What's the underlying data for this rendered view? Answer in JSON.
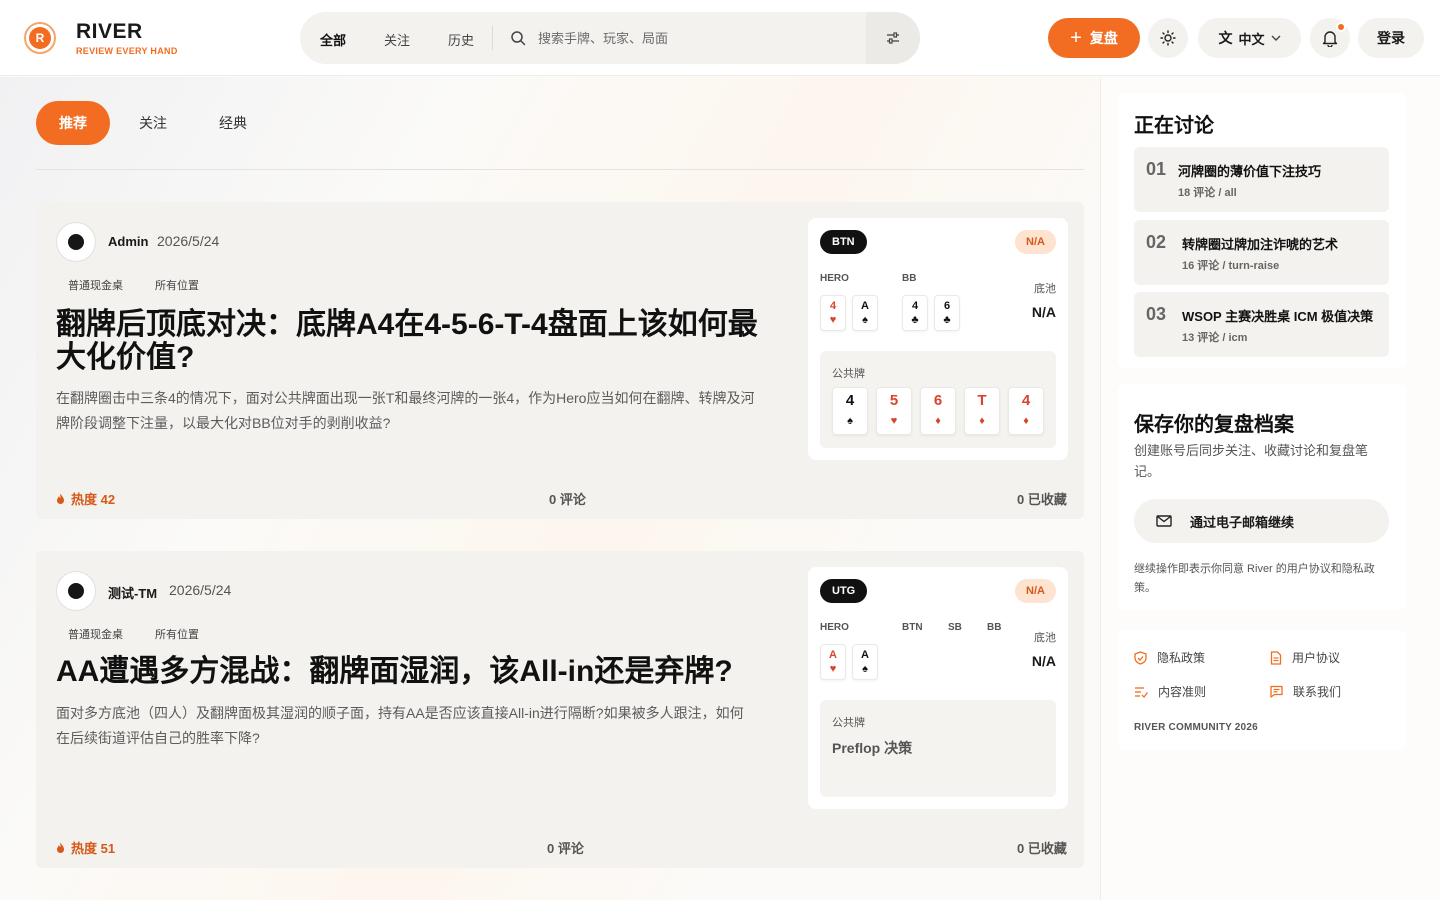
{
  "brand": {
    "logo_letter": "R",
    "name": "RIVER",
    "tagline": "REVIEW EVERY HAND"
  },
  "nav": {
    "tabs": [
      {
        "label": "全部",
        "active": true
      },
      {
        "label": "关注",
        "active": false
      },
      {
        "label": "历史",
        "active": false
      }
    ],
    "search_placeholder": "搜索手牌、玩家、局面"
  },
  "header_actions": {
    "review_label": "复盘",
    "language_label": "中文",
    "login_label": "登录",
    "has_notification": true
  },
  "feed_tabs": [
    {
      "label": "推荐",
      "active": true
    },
    {
      "label": "关注",
      "active": false
    },
    {
      "label": "经典",
      "active": false
    }
  ],
  "posts": [
    {
      "author": "Admin",
      "date": "2026/5/24",
      "tags": [
        "普通现金桌",
        "所有位置"
      ],
      "title": "翻牌后顶底对决：底牌A4在4-5-6-T-4盘面上该如何最大化价值?",
      "description": "在翻牌圈击中三条4的情况下，面对公共牌面出现一张T和最终河牌的一张4，作为Hero应当如何在翻牌、转牌及河牌阶段调整下注量，以最大化对BB位对手的剥削收益?",
      "hot_label": "热度 42",
      "comments_label": "0 评论",
      "saves_label": "0 已收藏",
      "hand": {
        "position": "BTN",
        "result": "N/A",
        "pot_label": "底池",
        "pot_value": "N/A",
        "seats": [
          "HERO",
          "BB"
        ],
        "hero_cards": [
          {
            "rank": "4",
            "suit": "♥",
            "color": "red"
          },
          {
            "rank": "A",
            "suit": "♠",
            "color": "black"
          }
        ],
        "villain_cards": [
          {
            "rank": "4",
            "suit": "♣",
            "color": "black"
          },
          {
            "rank": "6",
            "suit": "♣",
            "color": "black"
          }
        ],
        "board_label": "公共牌",
        "board": [
          {
            "rank": "4",
            "suit": "♠",
            "color": "black"
          },
          {
            "rank": "5",
            "suit": "♥",
            "color": "red"
          },
          {
            "rank": "6",
            "suit": "♦",
            "color": "red"
          },
          {
            "rank": "T",
            "suit": "♦",
            "color": "red"
          },
          {
            "rank": "4",
            "suit": "♦",
            "color": "red"
          }
        ]
      }
    },
    {
      "author": "测试-TM",
      "date": "2026/5/24",
      "tags": [
        "普通现金桌",
        "所有位置"
      ],
      "title": "AA遭遇多方混战：翻牌面湿润，该All-in还是弃牌?",
      "description": "面对多方底池（四人）及翻牌面极其湿润的顺子面，持有AA是否应该直接All-in进行隔断?如果被多人跟注，如何在后续街道评估自己的胜率下降?",
      "hot_label": "热度 51",
      "comments_label": "0 评论",
      "saves_label": "0 已收藏",
      "hand": {
        "position": "UTG",
        "result": "N/A",
        "pot_label": "底池",
        "pot_value": "N/A",
        "seats": [
          "HERO",
          "BTN",
          "SB",
          "BB"
        ],
        "hero_cards": [
          {
            "rank": "A",
            "suit": "♥",
            "color": "red"
          },
          {
            "rank": "A",
            "suit": "♠",
            "color": "black"
          }
        ],
        "board_label": "公共牌",
        "board_text": "Preflop 决策"
      }
    }
  ],
  "sidebar": {
    "discussion_heading": "正在讨论",
    "discussions": [
      {
        "num": "01",
        "title": "河牌圈的薄价值下注技巧",
        "meta": "18 评论 / all"
      },
      {
        "num": "02",
        "title": "转牌圈过牌加注诈唬的艺术",
        "meta": "16 评论 / turn-raise"
      },
      {
        "num": "03",
        "title": "WSOP 主赛决胜桌 ICM 极值决策",
        "meta": "13 评论 / icm"
      }
    ],
    "signup_heading": "保存你的复盘档案",
    "signup_desc": "创建账号后同步关注、收藏讨论和复盘笔记。",
    "email_button": "通过电子邮箱继续",
    "legal_text": "继续操作即表示你同意 River 的用户协议和隐私政策。",
    "footer_links": [
      {
        "label": "隐私政策",
        "icon": "shield-check-icon"
      },
      {
        "label": "用户协议",
        "icon": "document-icon"
      },
      {
        "label": "内容准则",
        "icon": "list-check-icon"
      },
      {
        "label": "联系我们",
        "icon": "message-icon"
      }
    ],
    "copyright": "RIVER COMMUNITY 2026"
  },
  "colors": {
    "accent": "#f26d21",
    "card_red": "#d8442e",
    "badge_bg": "#fde3d0"
  }
}
